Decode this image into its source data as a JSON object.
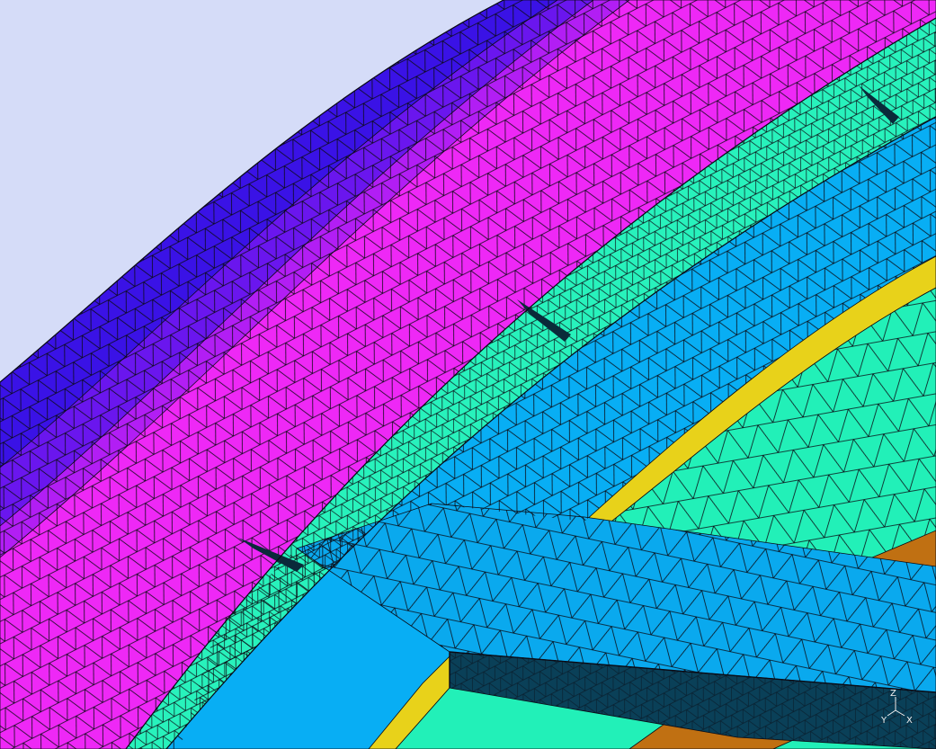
{
  "viewport": {
    "background": "#d5dcf8",
    "edge_color": "#0a0a14"
  },
  "layers": [
    {
      "name": "outer-shell-dark",
      "color": "#3a12e6"
    },
    {
      "name": "outer-shell-mid",
      "color": "#6a16ee"
    },
    {
      "name": "shell-violet",
      "color": "#b21ef4"
    },
    {
      "name": "shell-magenta",
      "color": "#ee28f6"
    },
    {
      "name": "ring-aquamarine",
      "color": "#28f2bc"
    },
    {
      "name": "stator-blue",
      "color": "#08aef4"
    },
    {
      "name": "rim-yellow",
      "color": "#e8d21a"
    },
    {
      "name": "inner-aquamarine",
      "color": "#22f0b8"
    },
    {
      "name": "arm-blue",
      "color": "#0aa9ee"
    },
    {
      "name": "arm-dark-side",
      "color": "#0a4058"
    },
    {
      "name": "base-brown",
      "color": "#c07012"
    }
  ],
  "axes_triad": {
    "labels": [
      "Z",
      "Y",
      "X"
    ]
  }
}
